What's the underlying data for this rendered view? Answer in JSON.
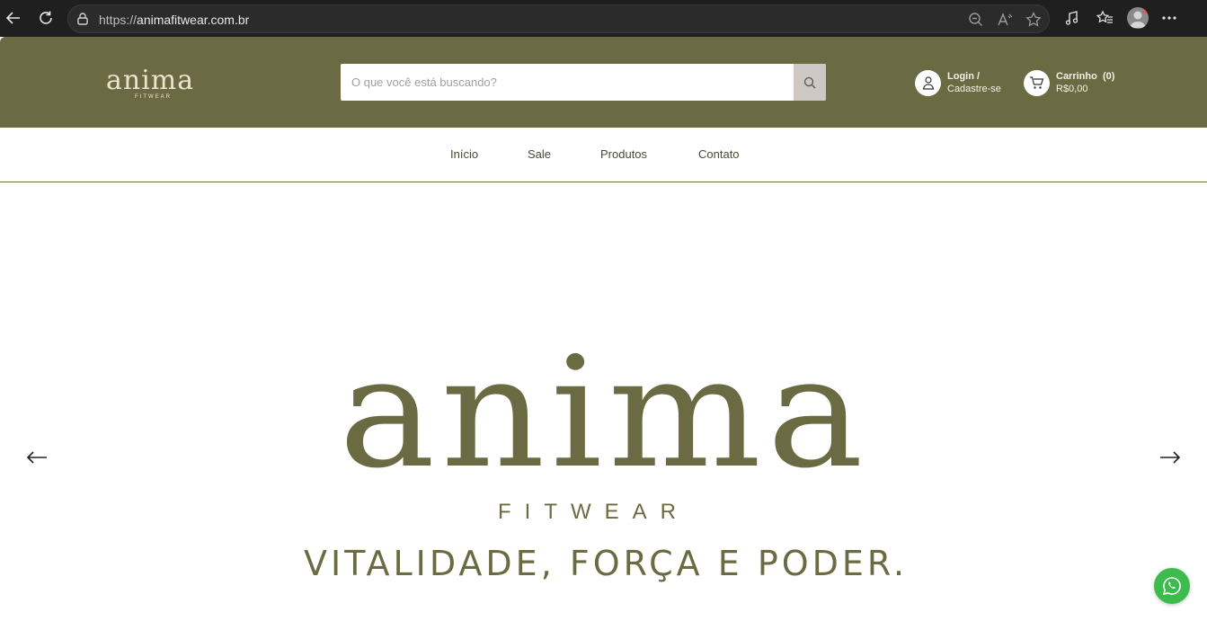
{
  "browser": {
    "url_protocol": "https://",
    "url_domain": "animafitwear.com.br"
  },
  "header": {
    "logo_text": "anima",
    "logo_sub": "FITWEAR",
    "search_placeholder": "O que você está buscando?",
    "account_line1": "Login /",
    "account_line2": "Cadastre-se",
    "cart_title": "Carrinho",
    "cart_count": "(0)",
    "cart_total": "R$0,00"
  },
  "menu": {
    "items": [
      "Início",
      "Sale",
      "Produtos",
      "Contato"
    ]
  },
  "hero": {
    "brand": "anima",
    "sub": "FITWEAR",
    "tagline": "VITALIDADE, FORÇA E PODER."
  },
  "colors": {
    "brand_olive": "#6b6b43",
    "whatsapp_green": "#3dbb4c",
    "browser_dark": "#1f1f1f"
  },
  "icons": [
    "back-arrow-icon",
    "reload-icon",
    "lock-icon",
    "zoom-out-icon",
    "read-aloud-icon",
    "favorite-star-icon",
    "media-icon",
    "favorites-list-icon",
    "profile-icon",
    "more-icon",
    "search-icon",
    "user-icon",
    "cart-icon",
    "arrow-left-icon",
    "arrow-right-icon",
    "whatsapp-icon"
  ]
}
